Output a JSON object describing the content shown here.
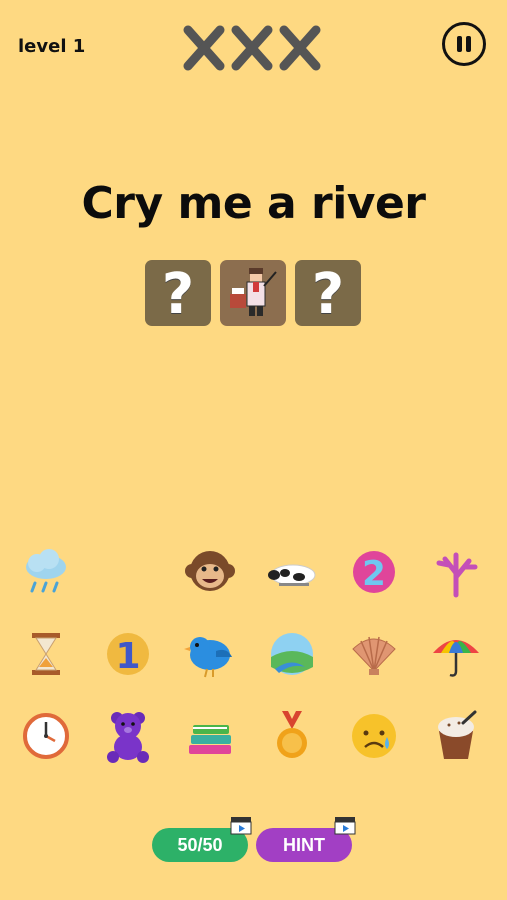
{
  "header": {
    "level_label": "level 1",
    "lives_icon": "three-crosses-lives",
    "pause_icon": "pause-icon"
  },
  "puzzle": {
    "title": "Cry me a river",
    "slots": [
      {
        "state": "hidden",
        "symbol": "?"
      },
      {
        "state": "revealed",
        "icon": "teacher-icon"
      },
      {
        "state": "hidden",
        "symbol": "?"
      }
    ]
  },
  "emoji_grid": [
    [
      "cloud-rain-icon",
      "empty",
      "monkey-face-icon",
      "cow-icon",
      "number-two-icon",
      "coral-icon"
    ],
    [
      "hourglass-icon",
      "number-one-icon",
      "bird-icon",
      "landscape-river-icon",
      "shell-icon",
      "umbrella-icon"
    ],
    [
      "clock-icon",
      "teddy-bear-icon",
      "books-icon",
      "medal-icon",
      "crying-face-icon",
      "ice-cream-cup-icon"
    ]
  ],
  "actions": {
    "fifty_fifty_label": "50/50",
    "hint_label": "HINT",
    "video_badge_icon": "clapperboard-icon"
  },
  "colors": {
    "background": "#FED982",
    "slot": "#7B6A48",
    "fifty_fifty": "#2DB168",
    "hint": "#A23FC4"
  }
}
